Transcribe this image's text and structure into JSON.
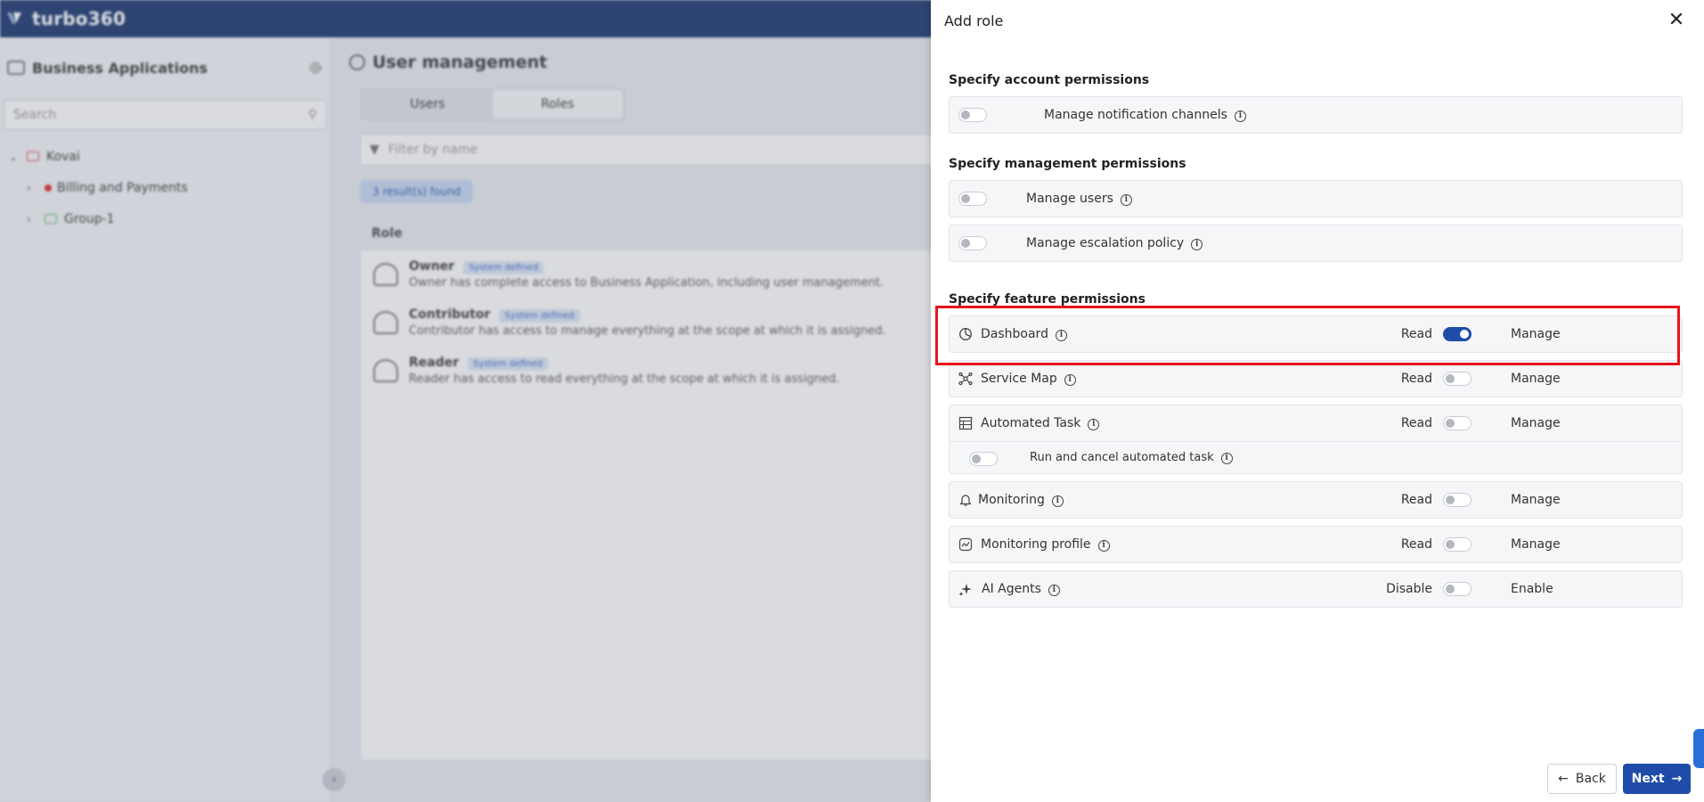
{
  "app": {
    "brand": "turbo360",
    "sidebar": {
      "title": "Business Applications",
      "search_placeholder": "Search",
      "tree": [
        {
          "label": "Kovai"
        },
        {
          "label": "Billing and Payments"
        },
        {
          "label": "Group-1"
        }
      ]
    },
    "main": {
      "title": "User management",
      "tabs": [
        {
          "label": "Users"
        },
        {
          "label": "Roles"
        }
      ],
      "filter_placeholder": "Filter by name",
      "results": "3 result(s) found",
      "table_header": "Role",
      "roles": [
        {
          "name": "Owner",
          "badge": "System defined",
          "desc": "Owner has complete access to Business Application, including user management."
        },
        {
          "name": "Contributor",
          "badge": "System defined",
          "desc": "Contributor has access to manage everything at the scope at which it is assigned."
        },
        {
          "name": "Reader",
          "badge": "System defined",
          "desc": "Reader has access to read everything at the scope at which it is assigned."
        }
      ]
    }
  },
  "drawer": {
    "title": "Add role",
    "account_section": "Specify account permissions",
    "account_permissions": [
      {
        "label": "Manage notification channels",
        "enabled": false
      }
    ],
    "management_section": "Specify management permissions",
    "management_permissions": [
      {
        "label": "Manage users",
        "enabled": false
      },
      {
        "label": "Manage escalation policy",
        "enabled": false
      }
    ],
    "feature_section": "Specify feature permissions",
    "features": [
      {
        "label": "Dashboard",
        "icon": "dashboard-icon",
        "left": "Read",
        "right": "Manage",
        "on": true
      },
      {
        "label": "Service Map",
        "icon": "service-map-icon",
        "left": "Read",
        "right": "Manage",
        "on": false
      },
      {
        "label": "Automated Task",
        "icon": "automated-task-icon",
        "left": "Read",
        "right": "Manage",
        "on": false,
        "sub": "Run and cancel automated task"
      },
      {
        "label": "Monitoring",
        "icon": "bell-icon",
        "left": "Read",
        "right": "Manage",
        "on": false
      },
      {
        "label": "Monitoring profile",
        "icon": "monitoring-profile-icon",
        "left": "Read",
        "right": "Manage",
        "on": false
      },
      {
        "label": "AI Agents",
        "icon": "sparkle-icon",
        "left": "Disable",
        "right": "Enable",
        "on": false
      }
    ],
    "back_label": "Back",
    "next_label": "Next"
  },
  "colors": {
    "brand_navy": "#13306b",
    "accent": "#1f4ca8",
    "highlight": "#e8141b"
  }
}
